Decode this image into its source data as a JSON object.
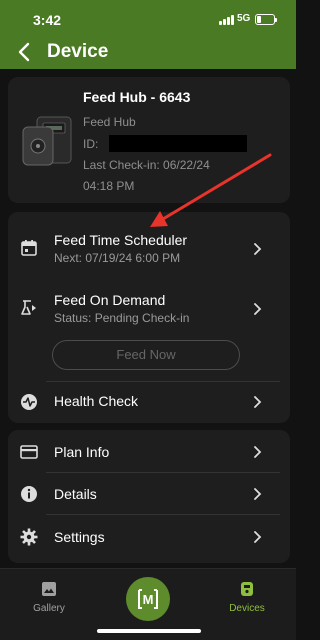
{
  "status_bar": {
    "time": "3:42",
    "network": "5G",
    "battery_percent": 15
  },
  "header": {
    "title": "Device"
  },
  "device": {
    "name": "Feed Hub - 6643",
    "type": "Feed Hub",
    "id_label": "ID:",
    "last_checkin": "Last Check-in: 06/22/24",
    "last_checkin_time": "04:18 PM"
  },
  "feed": {
    "scheduler_title": "Feed Time Scheduler",
    "scheduler_next": "Next: 07/19/24 6:00 PM",
    "on_demand_title": "Feed On Demand",
    "on_demand_status": "Status: Pending Check-in",
    "feed_now_label": "Feed Now",
    "health_check_title": "Health Check"
  },
  "info": {
    "plan_info": "Plan Info",
    "details": "Details",
    "settings": "Settings"
  },
  "tabbar": {
    "gallery": "Gallery",
    "devices": "Devices",
    "center_logo": "M",
    "active_tab": "Devices"
  },
  "colors": {
    "header_green": "#4a7a23",
    "fab_green": "#5e8c2d",
    "active_tab": "#8fbf3f",
    "inactive_tab": "#a0a0a0",
    "annotation_arrow": "#e8342a"
  },
  "icons": {
    "back": "chevron-left-icon",
    "scheduler": "calendar-icon",
    "on_demand": "feed-dispense-icon",
    "health": "heartbeat-icon",
    "plan": "credit-card-icon",
    "details": "info-icon",
    "settings": "gear-icon",
    "gallery": "image-icon",
    "devices": "device-icon"
  }
}
